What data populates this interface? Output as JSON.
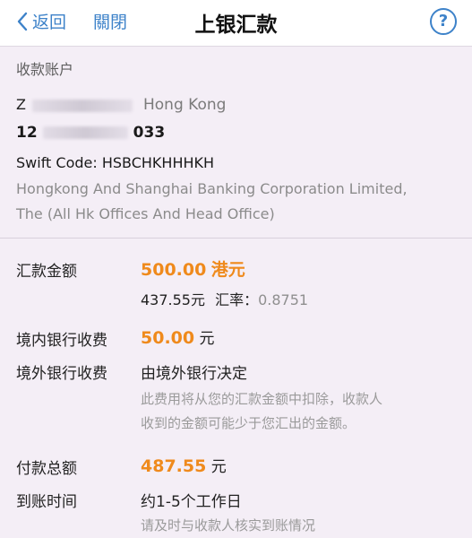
{
  "nav": {
    "back_label": "返回",
    "close_label": "關閉",
    "title": "上银汇款",
    "help_symbol": "?"
  },
  "account": {
    "section_title": "收款账户",
    "name_prefix": "Z",
    "location": "Hong Kong",
    "number_prefix": "12",
    "number_suffix": "033",
    "swift": "Swift Code: HSBCHKHHHKH",
    "bank_line_1": "Hongkong And Shanghai Banking Corporation Limited,",
    "bank_line_2": "The (All Hk Offices And Head Office)"
  },
  "details": {
    "amount_label": "汇款金额",
    "amount_value": "500.00",
    "amount_currency": "港元",
    "converted_amount": "437.55元",
    "rate_label": "汇率：",
    "rate_value": "0.8751",
    "domestic_fee_label": "境内银行收费",
    "domestic_fee_value": "50.00",
    "domestic_fee_unit": "元",
    "foreign_fee_label": "境外银行收费",
    "foreign_fee_value": "由境外银行决定",
    "foreign_fee_note_1": "此费用将从您的汇款金额中扣除，收款人",
    "foreign_fee_note_2": "收到的金额可能少于您汇出的金额。",
    "total_label": "付款总额",
    "total_value": "487.55",
    "total_unit": "元",
    "arrival_label": "到账时间",
    "arrival_value": "约1-5个工作日",
    "arrival_note": "请及时与收款人核实到账情况"
  },
  "colors": {
    "accent_blue": "#3d82c9",
    "amount_orange": "#ef8a1c",
    "background": "#f4eef6"
  }
}
